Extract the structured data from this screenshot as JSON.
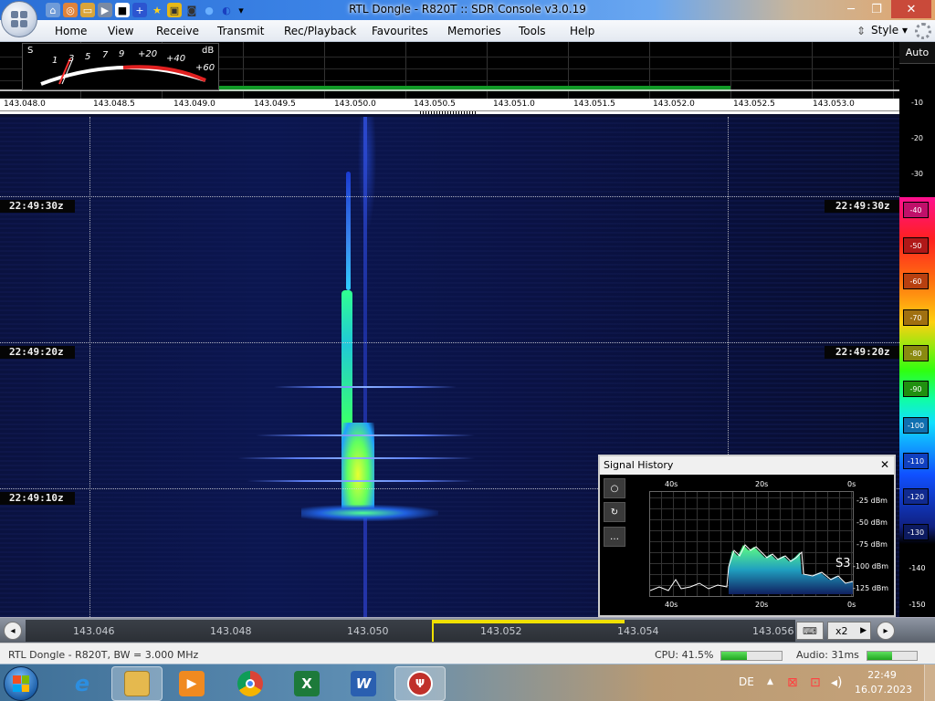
{
  "window": {
    "title": "RTL Dongle - R820T :: SDR Console v3.0.19",
    "minimize_glyph": "─",
    "restore_glyph": "❐",
    "close_glyph": "✕"
  },
  "quick_access": [
    "home-icon",
    "help-ring-icon",
    "folder-icon",
    "play-icon",
    "stop-icon",
    "plus-icon",
    "star-icon",
    "lock-icon",
    "camera-icon",
    "drop-icon",
    "speaker-icon",
    "dropdown-icon"
  ],
  "menu": {
    "items": [
      "Home",
      "View",
      "Receive",
      "Transmit",
      "Rec/Playback",
      "Favourites",
      "Memories",
      "Tools",
      "Help"
    ],
    "style_label": "Style",
    "style_arrow": "▾",
    "style_updown": "⇕"
  },
  "smeter": {
    "s_label": "S",
    "db_label": "dB",
    "marks": [
      "1",
      "3",
      "5",
      "7",
      "9",
      "+20",
      "+40",
      "+60"
    ]
  },
  "freq_scale": [
    "143.048.0",
    "143.048.5",
    "143.049.0",
    "143.049.5",
    "143.050.0",
    "143.050.5",
    "143.051.0",
    "143.051.5",
    "143.052.0",
    "143.052.5",
    "143.053.0"
  ],
  "level_scale": {
    "auto_label": "Auto",
    "levels": [
      "-10",
      "-20",
      "-30",
      "-40",
      "-50",
      "-60",
      "-70",
      "-80",
      "-90",
      "-100",
      "-110",
      "-120",
      "-130",
      "-140",
      "-150"
    ],
    "colors": {
      "-40": "#ff1090",
      "-50": "#ff2020",
      "-60": "#ff5010",
      "-70": "#ffa010",
      "-80": "#ffd010",
      "-90": "#40ff10",
      "-100": "#10e0ff",
      "-110": "#1060ff",
      "-120": "#1030c0",
      "-130": "#102080"
    }
  },
  "waterfall": {
    "time_labels": [
      "22:49:30z",
      "22:49:20z",
      "22:49:10z"
    ]
  },
  "signal_history": {
    "title": "Signal History",
    "close_glyph": "✕",
    "buttons": [
      "○",
      "↻",
      "…"
    ],
    "top_time": [
      "40s",
      "20s",
      "0s"
    ],
    "bottom_time": [
      "40s",
      "20s",
      "0s"
    ],
    "dbm_labels": [
      "-25 dBm",
      "-50 dBm",
      "-75 dBm",
      "-100 dBm",
      "-125 dBm"
    ],
    "s_unit": "S3"
  },
  "tuner": {
    "left_btn": "◂",
    "right_btn": "▸",
    "scale_labels": [
      "143.046",
      "143.048",
      "143.050",
      "143.052",
      "143.054",
      "143.056"
    ],
    "keyboard_glyph": "⌨",
    "zoom_label": "x2",
    "zoom_arrow": "▶"
  },
  "status": {
    "device": "RTL Dongle - R820T, BW = 3.000 MHz",
    "cpu": "CPU: 41.5%",
    "cpu_level": 0.42,
    "audio": "Audio: 31ms",
    "audio_level": 0.5
  },
  "taskbar": {
    "apps": [
      "ie-icon",
      "explorer-icon",
      "media-player-icon",
      "chrome-icon",
      "excel-icon",
      "word-icon",
      "sdr-console-icon"
    ],
    "lang": "DE",
    "tray_up": "▲",
    "time": "22:49",
    "date": "16.07.2023"
  }
}
